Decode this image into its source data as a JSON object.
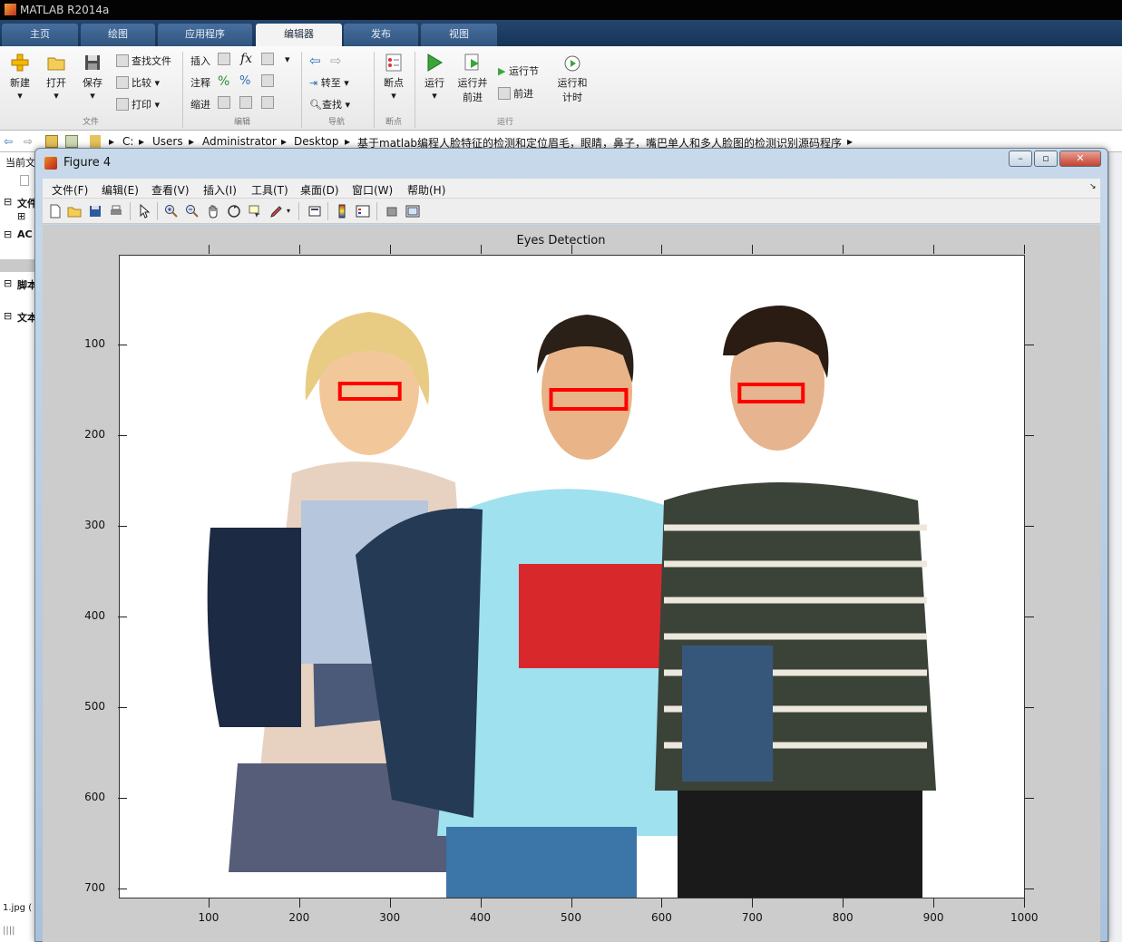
{
  "app": {
    "title": "MATLAB R2014a"
  },
  "tabs": [
    {
      "label": "主页"
    },
    {
      "label": "绘图"
    },
    {
      "label": "应用程序"
    },
    {
      "label": "编辑器"
    },
    {
      "label": "发布"
    },
    {
      "label": "视图"
    }
  ],
  "ribbon": {
    "new": "新建",
    "open": "打开",
    "save": "保存",
    "find_files": "查找文件",
    "compare": "比较",
    "print": "打印",
    "insert": "插入",
    "comment": "注释",
    "indent": "缩进",
    "goto": "转至",
    "find": "查找",
    "breakpoints": "断点",
    "run": "运行",
    "run_advance_1": "运行并",
    "run_advance_2": "前进",
    "run_section": "运行节",
    "advance": "前进",
    "run_time_1": "运行和",
    "run_time_2": "计时",
    "groups": {
      "file": "文件",
      "edit": "编辑",
      "navigate": "导航",
      "breakpoints": "断点",
      "run": "运行"
    }
  },
  "address": {
    "parts": [
      "C:",
      "Users",
      "Administrator",
      "Desktop",
      "基于matlab编程人脸特征的检测和定位眉毛，眼睛，鼻子，嘴巴单人和多人脸图的检测识别源码程序"
    ]
  },
  "left_panel": {
    "header": "当前文",
    "item1": "文件",
    "item2": "AC",
    "item3": "脚本",
    "item4": "文本",
    "footer": "1.jpg ("
  },
  "figure": {
    "title": "Figure 4",
    "menu": [
      "文件(F)",
      "编辑(E)",
      "查看(V)",
      "插入(I)",
      "工具(T)",
      "桌面(D)",
      "窗口(W)",
      "帮助(H)"
    ]
  },
  "chart_data": {
    "type": "image",
    "title": "Eyes Detection",
    "xticks": [
      100,
      200,
      300,
      400,
      500,
      600,
      700,
      800,
      900,
      1000
    ],
    "yticks": [
      100,
      200,
      300,
      400,
      500,
      600,
      700
    ],
    "xlim": [
      0,
      1000
    ],
    "ylim": [
      0,
      710
    ],
    "detections": [
      {
        "x": 243,
        "y": 141,
        "w": 66,
        "h": 17
      },
      {
        "x": 476,
        "y": 148,
        "w": 83,
        "h": 21
      },
      {
        "x": 684,
        "y": 142,
        "w": 70,
        "h": 19
      }
    ],
    "box_color": "#ff0000"
  },
  "colors": {
    "accent": "#1a3c64",
    "ribbon_tab_active": "#f3f3f3"
  }
}
